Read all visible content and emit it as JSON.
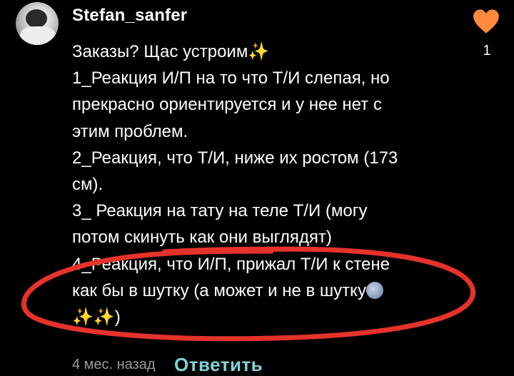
{
  "comment": {
    "username": "Stefan_sanfer",
    "lines": [
      "Заказы? Щас устроим✨",
      "1_Реакция И/П на то что Т/И слепая, но",
      "прекрасно ориентируется и у нее нет с",
      "этим проблем.",
      "2_Реакция, что Т/И, ниже их ростом (173",
      "см).",
      "3_ Реакция на тату на теле Т/И (могу",
      "потом скинуть как они выглядят)",
      "4_Реакция, что И/П, прижал Т/И к стене",
      "как бы в шутку (а может и не в шутку",
      "✨✨)"
    ],
    "likes": "1",
    "timestamp": "4 мес. назад",
    "reply_label": "Ответить"
  },
  "icons": {
    "like": "heart-icon",
    "moon_emoji": "full-moon-face-icon",
    "sparkles": "sparkles-icon"
  },
  "colors": {
    "background": "#000000",
    "heart": "#ff8a3d",
    "reply": "#7fd3d6",
    "annotation_ellipse": "#e5322a",
    "meta_text": "#9a9a9a"
  }
}
